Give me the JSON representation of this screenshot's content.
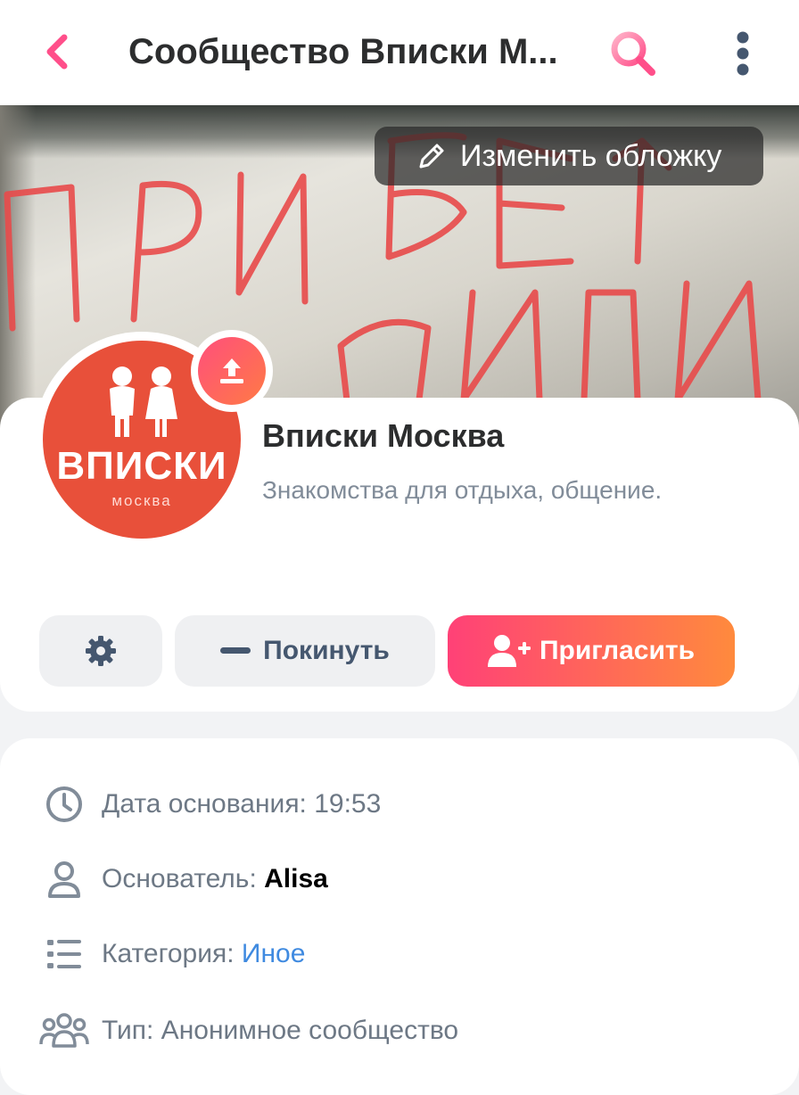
{
  "header": {
    "title": "Сообщество Вписки М...",
    "back_icon": "chevron-left-icon",
    "search_icon": "search-icon",
    "more_icon": "more-vertical-icon",
    "accent_color": "#ff4f8a"
  },
  "cover": {
    "edit_label": "Изменить обложку",
    "edit_icon": "pencil-icon"
  },
  "group": {
    "avatar_text": "ВПИСКИ",
    "avatar_subtext": "москва",
    "avatar_color": "#e8503a",
    "upload_icon": "upload-icon",
    "name": "Вписки Москва",
    "description": "Знакомства для отдыха, общение."
  },
  "actions": {
    "settings_icon": "gear-icon",
    "leave_label": "Покинуть",
    "leave_icon": "minus-icon",
    "invite_label": "Пригласить",
    "invite_icon": "add-user-icon"
  },
  "info": {
    "founded_label": "Дата основания: 19:53",
    "founder_prefix": "Основатель: ",
    "founder_name": "Alisa",
    "category_prefix": "Категория: ",
    "category_value": "Иное",
    "type_label": "Тип: Анонимное сообщество"
  }
}
